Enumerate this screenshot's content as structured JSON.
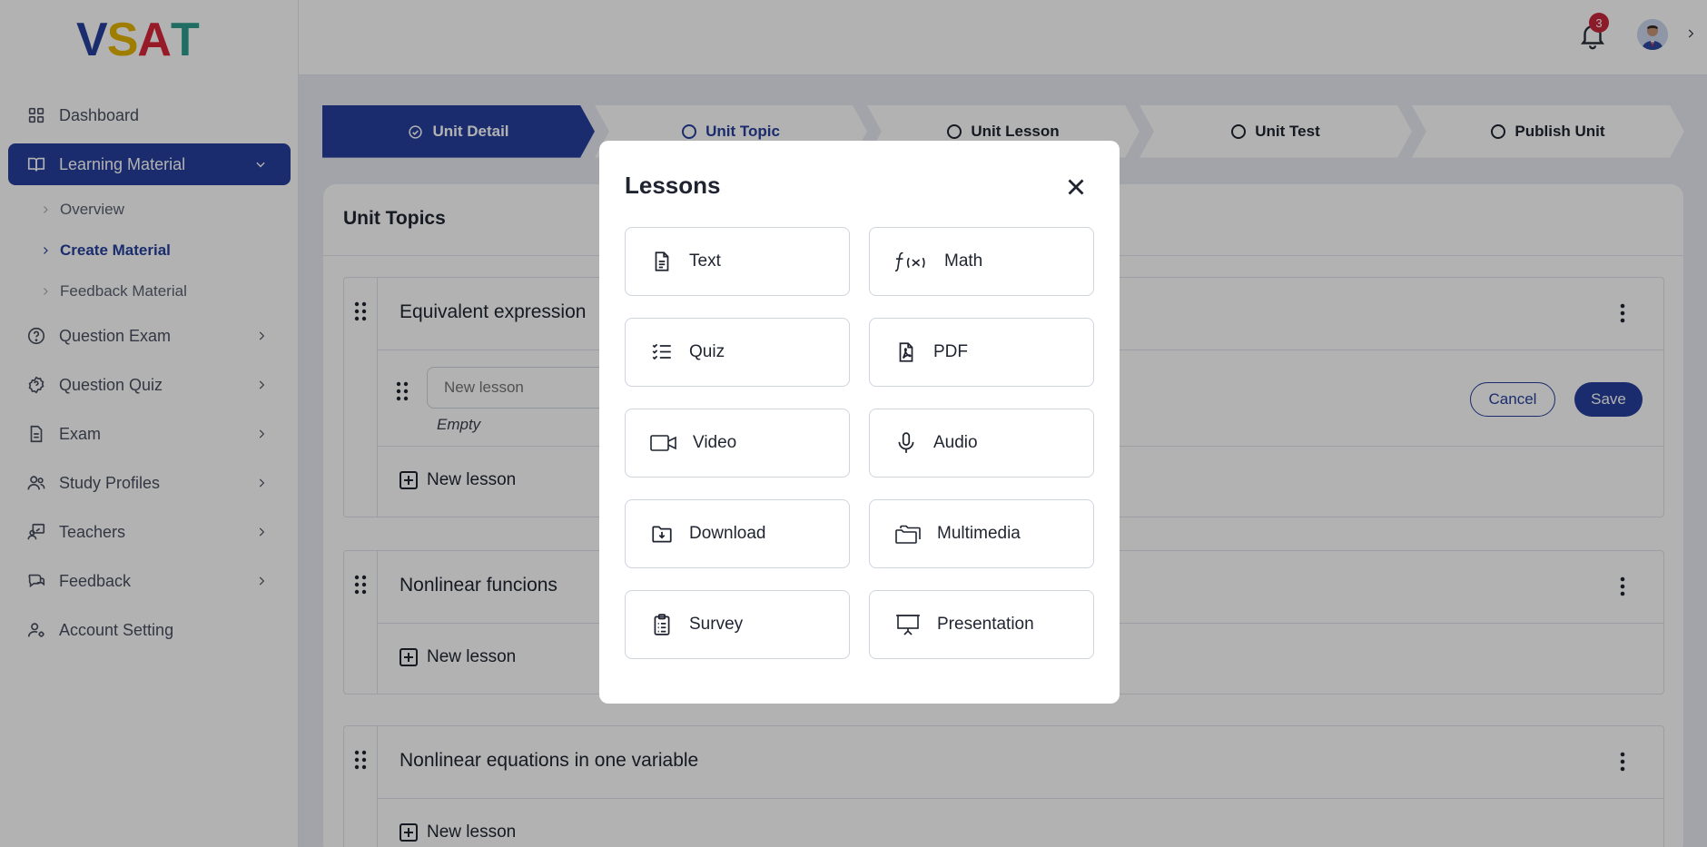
{
  "logo": {
    "letters": [
      "V",
      "S",
      "A",
      "T"
    ],
    "colors": [
      "#263f9c",
      "#e3b300",
      "#d9263c",
      "#2f9e8f"
    ]
  },
  "sidebar": {
    "items": [
      {
        "label": "Dashboard",
        "icon": "grid-icon"
      },
      {
        "label": "Learning Material",
        "icon": "book-icon",
        "active": true
      },
      {
        "label": "Question Exam",
        "icon": "question-circle-icon"
      },
      {
        "label": "Question Quiz",
        "icon": "question-badge-icon"
      },
      {
        "label": "Exam",
        "icon": "document-icon"
      },
      {
        "label": "Study Profiles",
        "icon": "users-icon"
      },
      {
        "label": "Teachers",
        "icon": "teacher-icon"
      },
      {
        "label": "Feedback",
        "icon": "chat-icon"
      },
      {
        "label": "Account Setting",
        "icon": "user-gear-icon"
      }
    ],
    "subitems": [
      {
        "label": "Overview"
      },
      {
        "label": "Create Material",
        "current": true
      },
      {
        "label": "Feedback Material"
      }
    ]
  },
  "header": {
    "notification_count": "3"
  },
  "stepper": {
    "steps": [
      {
        "label": "Unit Detail",
        "state": "done"
      },
      {
        "label": "Unit Topic",
        "state": "current"
      },
      {
        "label": "Unit Lesson",
        "state": "pending"
      },
      {
        "label": "Unit Test",
        "state": "pending"
      },
      {
        "label": "Publish Unit",
        "state": "pending"
      }
    ]
  },
  "card": {
    "title": "Unit Topics",
    "topics": [
      {
        "title": "Equivalent expression",
        "lesson_placeholder": "New lesson",
        "empty_label": "Empty",
        "cancel_label": "Cancel",
        "save_label": "Save",
        "new_lesson_label": "New lesson"
      },
      {
        "title": "Nonlinear funcions",
        "new_lesson_label": "New lesson"
      },
      {
        "title": "Nonlinear equations in one variable",
        "new_lesson_label": "New lesson"
      }
    ]
  },
  "modal": {
    "title": "Lessons",
    "options": [
      {
        "label": "Text",
        "icon": "text-file-icon"
      },
      {
        "label": "Math",
        "icon": "function-icon"
      },
      {
        "label": "Quiz",
        "icon": "checklist-icon"
      },
      {
        "label": "PDF",
        "icon": "pdf-file-icon"
      },
      {
        "label": "Video",
        "icon": "video-camera-icon"
      },
      {
        "label": "Audio",
        "icon": "microphone-icon"
      },
      {
        "label": "Download",
        "icon": "download-folder-icon"
      },
      {
        "label": "Multimedia",
        "icon": "folders-icon"
      },
      {
        "label": "Survey",
        "icon": "clipboard-icon"
      },
      {
        "label": "Presentation",
        "icon": "presentation-board-icon"
      }
    ]
  },
  "colors": {
    "accent": "#263f9c",
    "badge": "#c8283c"
  }
}
